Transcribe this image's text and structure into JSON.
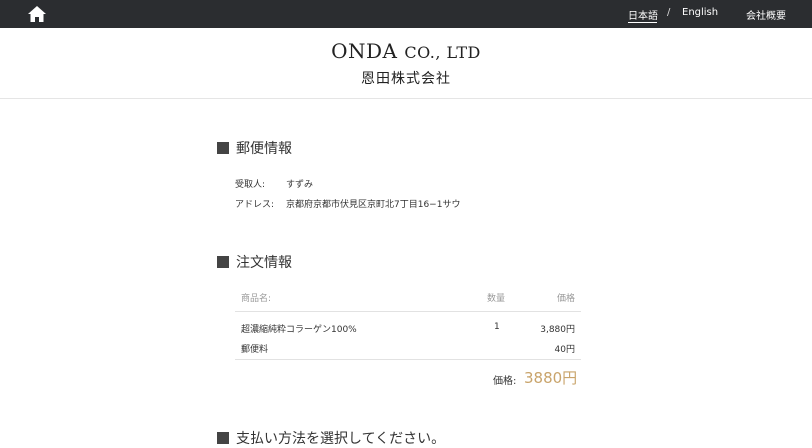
{
  "nav": {
    "home_icon": "home-icon",
    "lang_jp": "日本語",
    "separator": "/",
    "lang_en": "English",
    "company": "会社概要"
  },
  "brand": {
    "name_en_main": "ONDA ",
    "name_en_small": "CO., LTD",
    "name_jp": "恩田株式会社"
  },
  "shipping": {
    "title": "郵便情報",
    "recipient_label": "受取人:",
    "recipient_value": "すずみ",
    "address_label": "アドレス:",
    "address_value": "京都府京都市伏見区京町北7丁目16−1サウ"
  },
  "order": {
    "title": "注文情報",
    "headers": {
      "product": "商品名:",
      "qty": "数量",
      "price": "価格"
    },
    "items": [
      {
        "name": "超濃縮純粋コラーゲン100%",
        "qty": "1",
        "price": "3,880円"
      },
      {
        "name": "郵便料",
        "qty": "",
        "price": "40円"
      }
    ],
    "total_label": "価格:",
    "total_value": "3880円",
    "accent_color": "#c9a46b"
  },
  "payment": {
    "title": "支払い方法を選択してください。"
  }
}
